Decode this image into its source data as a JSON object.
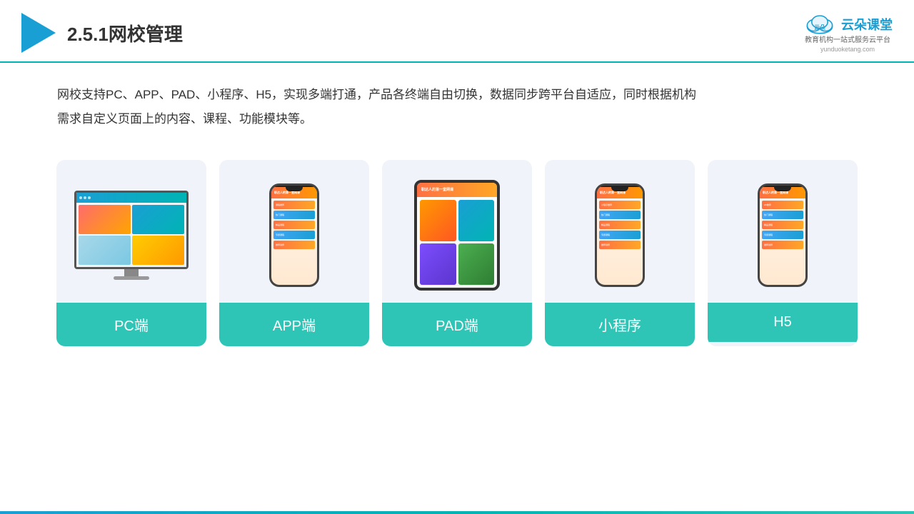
{
  "header": {
    "title": "2.5.1网校管理",
    "brand_name": "云朵课堂",
    "brand_sub1": "教育机构一站",
    "brand_sub2": "式服务云平台",
    "brand_url": "yunduoketang.com"
  },
  "description": {
    "text1": "网校支持PC、APP、PAD、小程序、H5，实现多端打通，产品各终端自由切换，数据同步跨平台自适应，同时根据机构",
    "text2": "需求自定义页面上的内容、课程、功能模块等。"
  },
  "cards": [
    {
      "id": "pc",
      "label": "PC端"
    },
    {
      "id": "app",
      "label": "APP端"
    },
    {
      "id": "pad",
      "label": "PAD端"
    },
    {
      "id": "miniprogram",
      "label": "小程序"
    },
    {
      "id": "h5",
      "label": "H5"
    }
  ]
}
